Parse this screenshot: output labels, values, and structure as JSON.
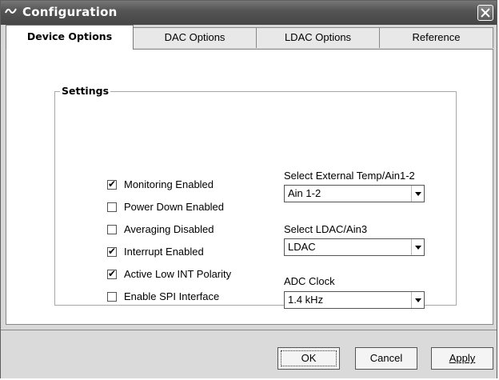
{
  "window": {
    "title": "Configuration",
    "app_icon": "waveform-icon",
    "close_icon": "close-icon"
  },
  "tabs": [
    {
      "label": "Device Options",
      "active": true
    },
    {
      "label": "DAC Options",
      "active": false
    },
    {
      "label": "LDAC Options",
      "active": false
    },
    {
      "label": "Reference",
      "active": false
    }
  ],
  "settings": {
    "group_label": "Settings",
    "checkboxes": [
      {
        "label": "Monitoring Enabled",
        "checked": true
      },
      {
        "label": "Power Down Enabled",
        "checked": false
      },
      {
        "label": "Averaging Disabled",
        "checked": false
      },
      {
        "label": "Interrupt Enabled",
        "checked": true
      },
      {
        "label": "Active Low INT Polarity",
        "checked": true
      },
      {
        "label": "Enable SPI Interface",
        "checked": false
      }
    ],
    "selects": [
      {
        "label": "Select External Temp/Ain1-2",
        "value": "Ain 1-2"
      },
      {
        "label": "Select LDAC/Ain3",
        "value": "LDAC"
      },
      {
        "label": "ADC Clock",
        "value": "1.4 kHz"
      }
    ]
  },
  "buttons": {
    "ok": "OK",
    "cancel": "Cancel",
    "apply": "Apply"
  },
  "check_mark": "✔"
}
